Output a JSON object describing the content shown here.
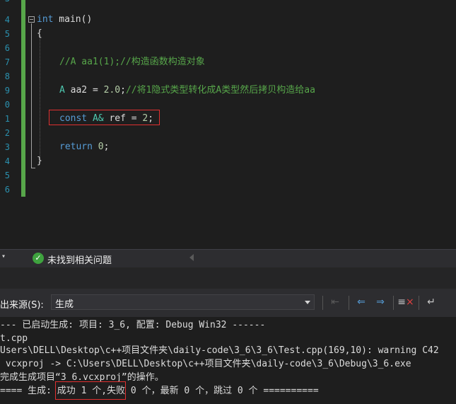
{
  "editor": {
    "line_numbers": [
      "3",
      "4",
      "5",
      "6",
      "7",
      "8",
      "9",
      "0",
      "1",
      "2",
      "3",
      "4",
      "5",
      "6"
    ],
    "code": {
      "main_kw": "int",
      "main_name": " main()",
      "brace_open": "{",
      "line_comment": "//A aa1(1);//构造函数构造对象",
      "aa2_type": "A",
      "aa2_name": " aa2",
      "aa2_eq": " = ",
      "aa2_val": "2.0",
      "aa2_semi": ";",
      "aa2_comment": "//将1隐式类型转化成A类型然后拷贝构造给aa",
      "ref_kw": "const",
      "ref_type": " A&",
      "ref_name": " ref",
      "ref_eq": " = ",
      "ref_val": "2",
      "ref_semi": ";",
      "return_kw": "return",
      "return_val": " 0",
      "return_semi": ";",
      "brace_close": "}"
    }
  },
  "status": {
    "message": "未找到相关问题"
  },
  "output_panel": {
    "source_label": "出来源(S):",
    "source_value": "生成"
  },
  "output_lines": [
    "--- 已启动生成: 项目: 3_6, 配置: Debug Win32 ------",
    "t.cpp",
    "Users\\DELL\\Desktop\\c++项目文件夹\\daily-code\\3_6\\3_6\\Test.cpp(169,10): warning C42",
    " vcxproj -> C:\\Users\\DELL\\Desktop\\c++项目文件夹\\daily-code\\3_6\\Debug\\3_6.exe",
    "完成生成项目“3_6.vcxproj”的操作。"
  ],
  "summary": {
    "prefix": "==== 生成:",
    "success": " 成功 1 个,",
    "rest": "失败 0 个，最新 0 个，跳过 0 个 =========="
  },
  "colors": {
    "keyword": "#569cd6",
    "comment": "#57a64a",
    "number": "#b5cea8",
    "highlight_box": "#e03030",
    "success_check": "#3fa33f"
  }
}
